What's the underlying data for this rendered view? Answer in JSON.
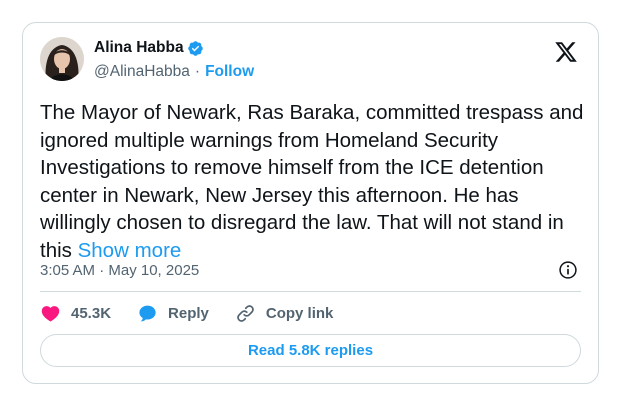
{
  "author": {
    "name": "Alina Habba",
    "handle": "@AlinaHabba",
    "separator": "·",
    "follow_label": "Follow"
  },
  "tweet": {
    "text": "The Mayor of Newark, Ras Baraka, committed trespass and ignored multiple warnings from Homeland Security Investigations to remove himself from the ICE detention center in Newark, New Jersey this afternoon.  He has willingly chosen to disregard the law. That will not stand in this ",
    "show_more_label": "Show more",
    "timestamp": "3:05 AM · May 10, 2025"
  },
  "actions": {
    "likes": "45.3K",
    "reply_label": "Reply",
    "copy_link_label": "Copy link"
  },
  "read_replies_label": "Read 5.8K replies",
  "icons": {
    "verified": "verified-badge-icon",
    "brand": "x-logo-icon",
    "info": "info-icon",
    "like": "heart-icon",
    "reply": "reply-bubble-icon",
    "copy": "link-icon"
  },
  "colors": {
    "accent": "#1d9bf0",
    "like": "#f91880",
    "text": "#0f1419",
    "muted": "#536471",
    "border": "#cfd9de"
  }
}
